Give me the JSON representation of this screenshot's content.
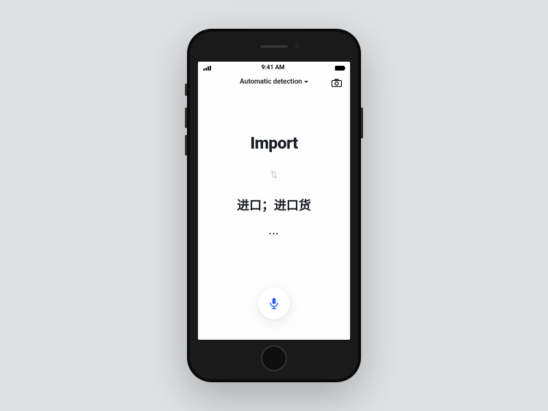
{
  "statusBar": {
    "time": "9:41 AM"
  },
  "header": {
    "languageMode": "Automatic detection"
  },
  "translation": {
    "sourceText": "Import",
    "targetText": "进口；进口货",
    "moreIndicator": "..."
  },
  "colors": {
    "micAccent": "#2b62ff"
  }
}
